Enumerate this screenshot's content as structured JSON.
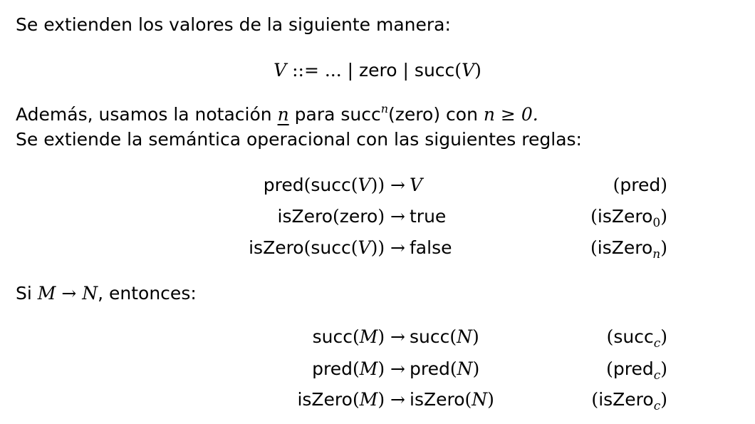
{
  "intro": "Se extienden los valores de la siguiente manera:",
  "grammar": {
    "lhs": "V",
    "def": "::=",
    "dots": "...",
    "bar": "|",
    "zero": "zero",
    "succ": "succ",
    "var": "V"
  },
  "notation": {
    "prefix": "Además, usamos la notación",
    "n": "n",
    "mid": "para succ",
    "sup": "n",
    "arg": "(zero) con",
    "cond": "n ≥ 0."
  },
  "extends": "Se extiende la semántica operacional con las siguientes reglas:",
  "rules": [
    {
      "lhs": "pred(succ(V))",
      "arrow": "→",
      "rhs": "V",
      "label": "pred",
      "sub": ""
    },
    {
      "lhs": "isZero(zero)",
      "arrow": "→",
      "rhs": "true",
      "label": "isZero",
      "sub": "0"
    },
    {
      "lhs": "isZero(succ(V))",
      "arrow": "→",
      "rhs": "false",
      "label": "isZero",
      "sub": "n"
    }
  ],
  "condition": {
    "si": "Si",
    "m": "M",
    "arrow": "→",
    "n": "N",
    "rest": ", entonces:"
  },
  "congruence": [
    {
      "lhs": "succ(M)",
      "arrow": "→",
      "rhs": "succ(N)",
      "label": "succ",
      "sub": "c"
    },
    {
      "lhs": "pred(M)",
      "arrow": "→",
      "rhs": "pred(N)",
      "label": "pred",
      "sub": "c"
    },
    {
      "lhs": "isZero(M)",
      "arrow": "→",
      "rhs": "isZero(N)",
      "label": "isZero",
      "sub": "c"
    }
  ]
}
